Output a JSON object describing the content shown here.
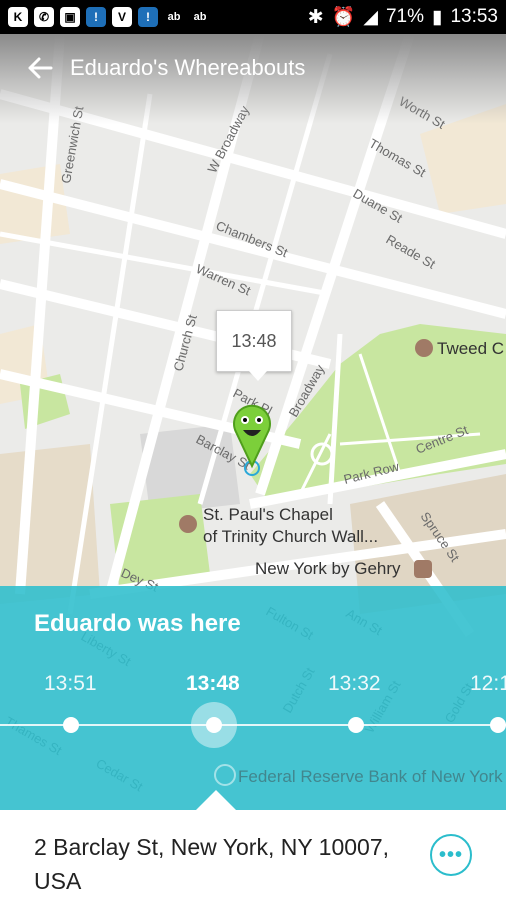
{
  "status_bar": {
    "left_icons": [
      "k-app-icon",
      "whatsapp-icon",
      "gallery-icon",
      "app-icon",
      "vine-icon",
      "app-icon",
      "ab-icon",
      "ab-icon"
    ],
    "battery": "71%",
    "time": "13:53"
  },
  "app_bar": {
    "title": "Eduardo's Whereabouts"
  },
  "map": {
    "streets": [
      "Greenwich St",
      "W Broadway",
      "Thomas St",
      "Worth St",
      "Duane St",
      "Chambers St",
      "Reade St",
      "Warren St",
      "Church St",
      "Park Pl",
      "Barclay St",
      "Broadway",
      "Park Row",
      "Centre St",
      "Spruce St",
      "Dey St",
      "Fulton St",
      "Ann St",
      "Dutch St",
      "William St",
      "Liberty St",
      "Cedar St",
      "Gold St",
      "Thames St"
    ],
    "pois": [
      "Tweed C",
      "St. Paul's Chapel of Trinity Church Wall...",
      "New York by Gehry",
      "Federal Reserve Bank of New York"
    ],
    "callout_time": "13:48"
  },
  "timeline": {
    "title": "Eduardo was here",
    "times": [
      "13:51",
      "13:48",
      "13:32",
      "12:1"
    ],
    "selected": "13:48"
  },
  "address": {
    "text": "2 Barclay St, New York, NY 10007, USA",
    "more_label": "•••"
  },
  "colors": {
    "accent": "#2bbdcc",
    "park": "#c8e6a0",
    "marker": "#7ccf3a"
  }
}
